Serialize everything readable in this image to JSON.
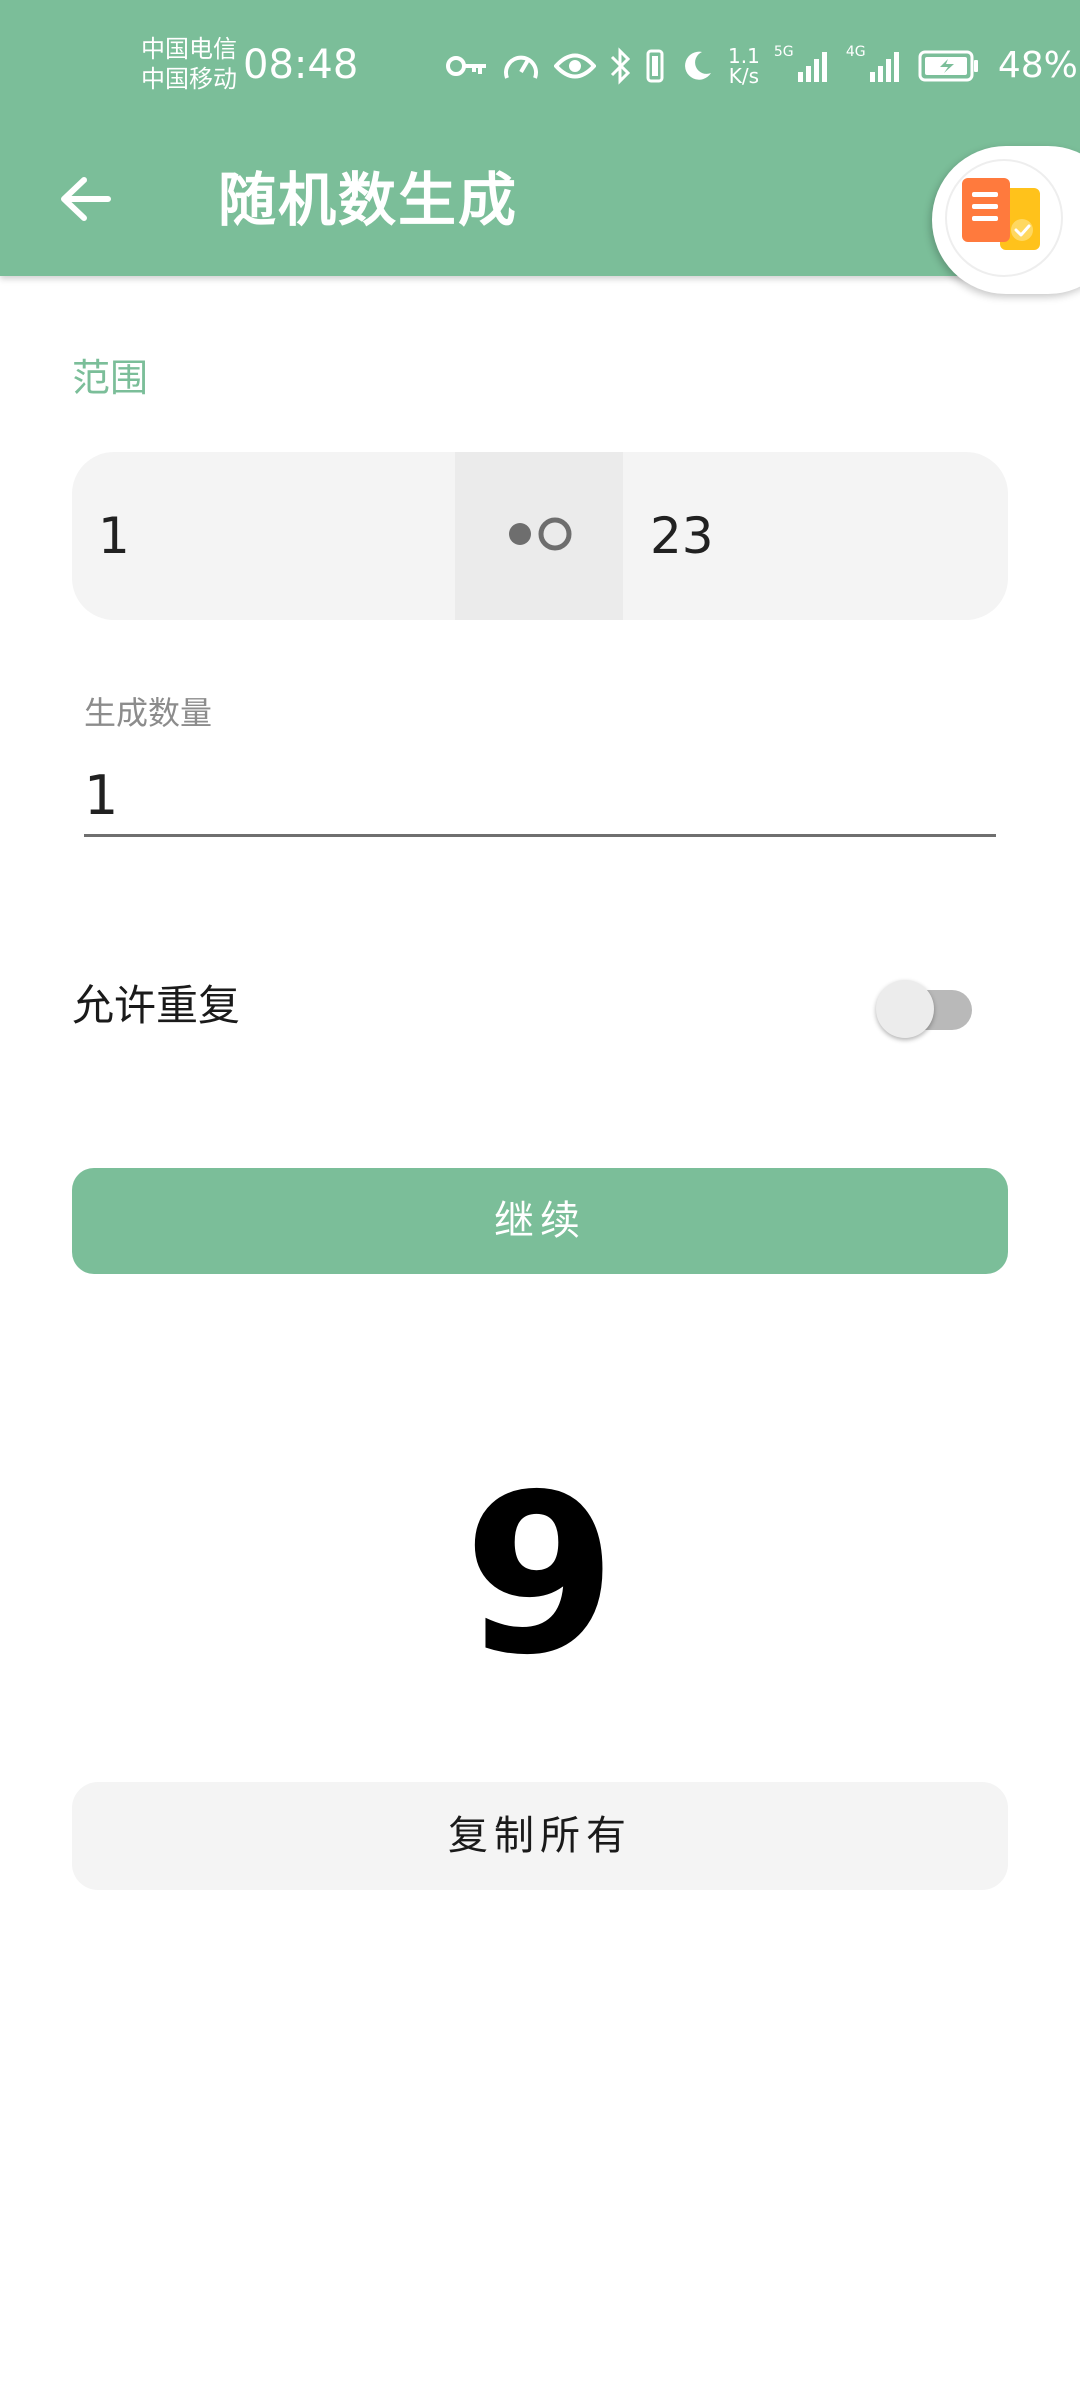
{
  "status_bar": {
    "carrier_1": "中国电信",
    "carrier_2": "中国移动",
    "time": "08:48",
    "net_speed_value": "1.1",
    "net_speed_unit": "K/s",
    "sim1_tech": "5G",
    "sim2_tech": "4G",
    "battery_percent": "48%",
    "icons": [
      "key-icon",
      "speedometer-icon",
      "eye-icon",
      "bluetooth-icon",
      "vibrate-icon",
      "moon-icon",
      "signal-icon",
      "battery-charging-icon"
    ]
  },
  "toolbar": {
    "back_icon": "arrow-back-icon",
    "title": "随机数生成"
  },
  "floating_bubble": {
    "icon": "clipboard-app-icon"
  },
  "range": {
    "label": "范围",
    "min": "1",
    "max": "23",
    "switch_icon": "range-toggle-icon"
  },
  "quantity": {
    "label": "生成数量",
    "value": "1"
  },
  "allow_repeat": {
    "label": "允许重复",
    "enabled": false
  },
  "continue_button": {
    "label": "继续"
  },
  "result": {
    "value": "9"
  },
  "copy_button": {
    "label": "复制所有"
  },
  "colors": {
    "accent": "#7bbe99",
    "field_background": "#f4f4f4",
    "result_text": "#000000"
  }
}
